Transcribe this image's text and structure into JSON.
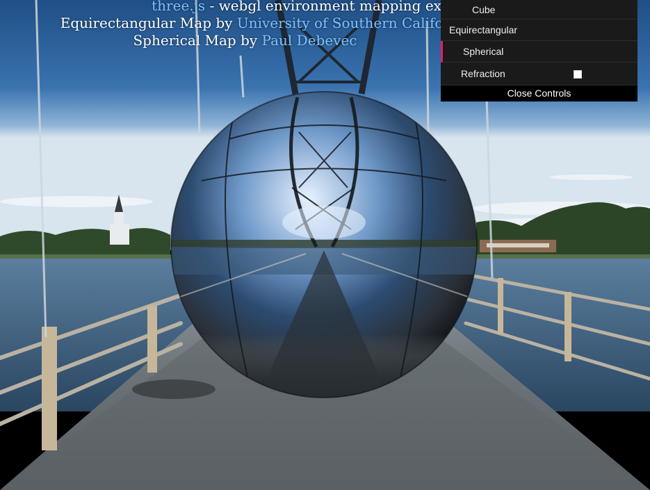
{
  "info": {
    "line1_link": "three.js",
    "line1_text": " - webgl environment mapping example",
    "line2_text": "Equirectangular Map by ",
    "line2_link": "University of Southern California",
    "line3_text": "Spherical Map by ",
    "line3_link": "Paul Debevec"
  },
  "gui": {
    "items": [
      {
        "label": "Cube"
      },
      {
        "label": "Equirectangular"
      },
      {
        "label": "Spherical"
      },
      {
        "label": "Refraction"
      }
    ],
    "refraction_checked": false,
    "close_label": "Close Controls",
    "accent_color": "#e61d5f"
  }
}
